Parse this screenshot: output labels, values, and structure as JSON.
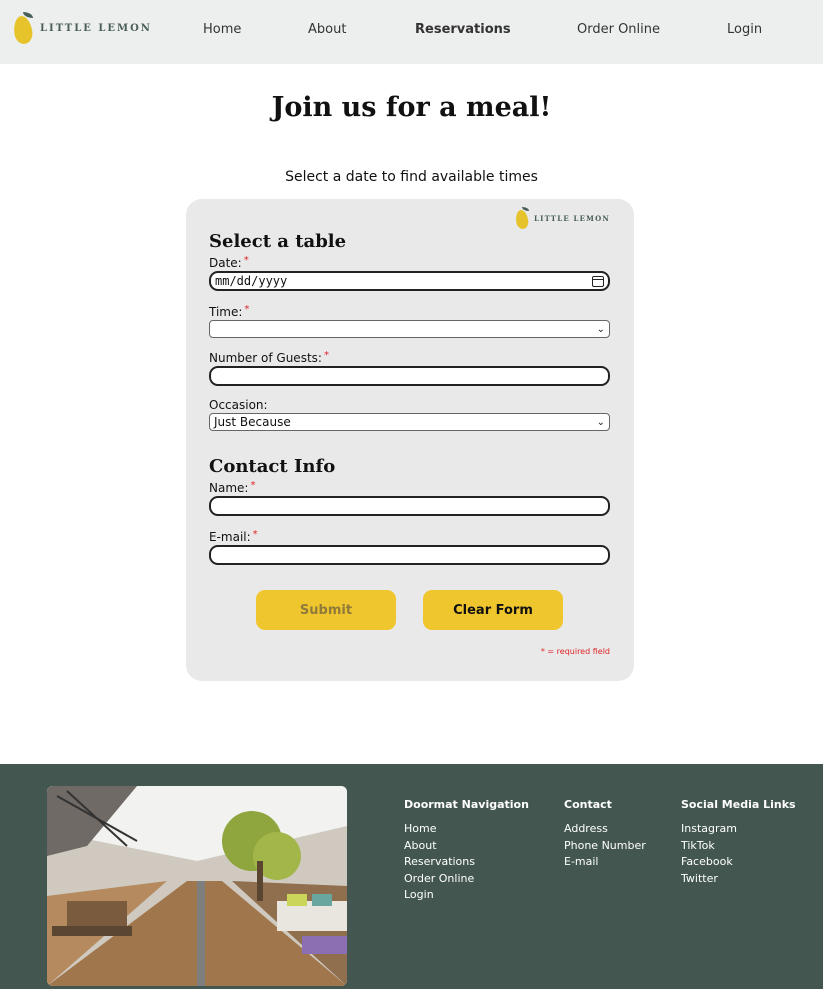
{
  "header": {
    "logo_text": "LITTLE LEMON",
    "nav": [
      {
        "label": "Home",
        "active": false
      },
      {
        "label": "About",
        "active": false
      },
      {
        "label": "Reservations",
        "active": true
      },
      {
        "label": "Order Online",
        "active": false
      },
      {
        "label": "Login",
        "active": false
      }
    ]
  },
  "main": {
    "title": "Join us for a meal!",
    "subtitle": "Select a date to find available times"
  },
  "form": {
    "logo_text": "LITTLE LEMON",
    "section_table": "Select a table",
    "date_label": "Date:",
    "date_placeholder": "mm/dd/yyyy",
    "time_label": "Time:",
    "time_value": "",
    "guests_label": "Number of Guests:",
    "guests_value": "",
    "occasion_label": "Occasion:",
    "occasion_value": "Just Because",
    "section_contact": "Contact Info",
    "name_label": "Name:",
    "name_value": "",
    "email_label": "E-mail:",
    "email_value": "",
    "required_mark": "*",
    "submit_label": "Submit",
    "clear_label": "Clear Form",
    "required_note": "* = required field"
  },
  "footer": {
    "image_alt": "restaurant patio",
    "columns": [
      {
        "heading": "Doormat Navigation",
        "items": [
          "Home",
          "About",
          "Reservations",
          "Order Online",
          "Login"
        ]
      },
      {
        "heading": "Contact",
        "items": [
          "Address",
          "Phone Number",
          "E-mail"
        ]
      },
      {
        "heading": "Social Media Links",
        "items": [
          "Instagram",
          "TikTok",
          "Facebook",
          "Twitter"
        ]
      }
    ]
  },
  "colors": {
    "header_bg": "#edefee",
    "brand_yellow": "#f0c62e",
    "brand_green": "#495e57",
    "footer_bg": "#435750",
    "required_red": "#e0252b"
  }
}
